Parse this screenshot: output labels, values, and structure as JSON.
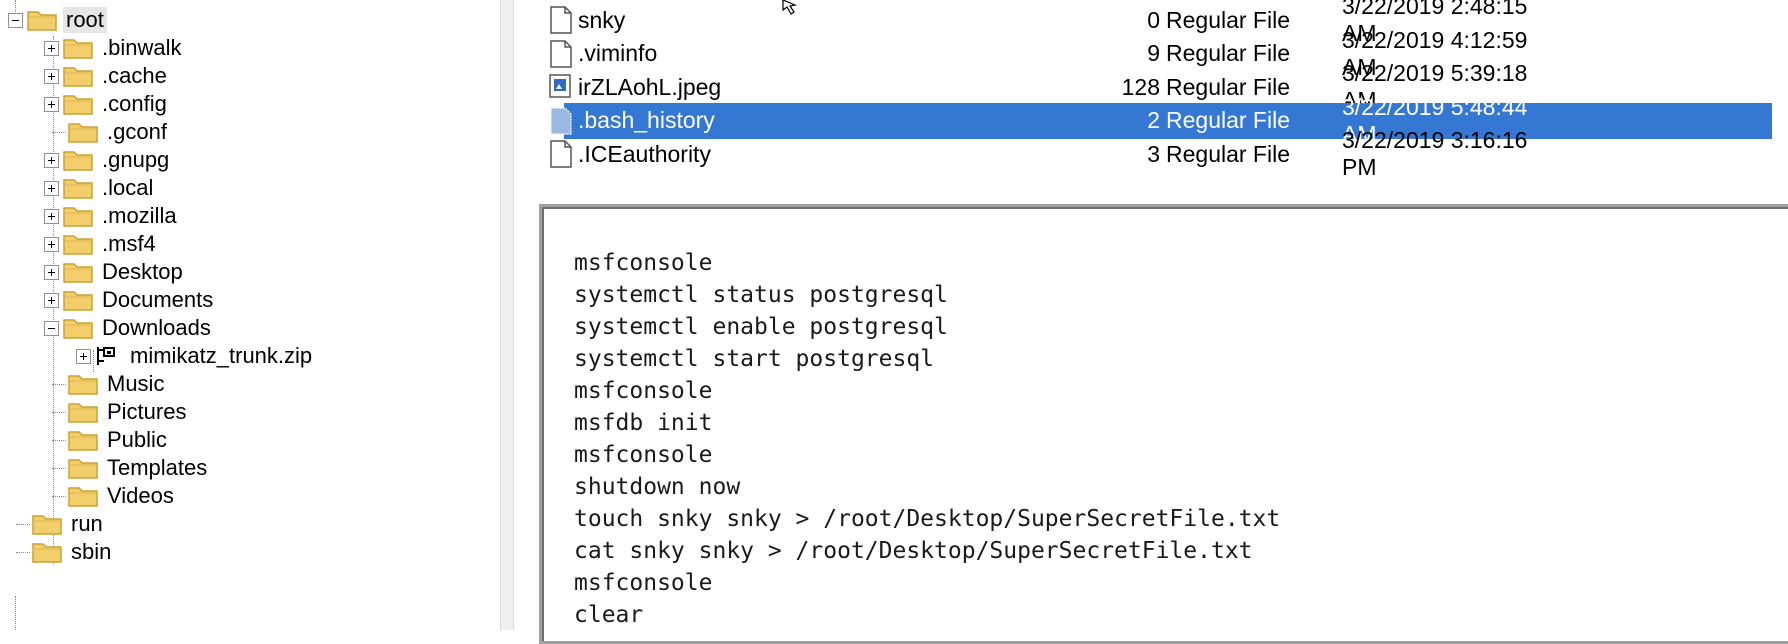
{
  "tree": {
    "root_label": "root",
    "items": [
      {
        "label": ".binwalk",
        "expandable": true
      },
      {
        "label": ".cache",
        "expandable": true
      },
      {
        "label": ".config",
        "expandable": true
      },
      {
        "label": ".gconf",
        "expandable": false
      },
      {
        "label": ".gnupg",
        "expandable": true
      },
      {
        "label": ".local",
        "expandable": true
      },
      {
        "label": ".mozilla",
        "expandable": true
      },
      {
        "label": ".msf4",
        "expandable": true
      },
      {
        "label": "Desktop",
        "expandable": true
      },
      {
        "label": "Documents",
        "expandable": true
      },
      {
        "label": "Downloads",
        "expanded": true
      },
      {
        "label": "mimikatz_trunk.zip",
        "child": true
      },
      {
        "label": "Music",
        "expandable": false
      },
      {
        "label": "Pictures",
        "expandable": false
      },
      {
        "label": "Public",
        "expandable": false
      },
      {
        "label": "Templates",
        "expandable": false
      },
      {
        "label": "Videos",
        "expandable": false
      }
    ],
    "after_root": [
      {
        "label": "run"
      },
      {
        "label": "sbin"
      }
    ]
  },
  "files": [
    {
      "name": "snky",
      "size": "0",
      "type": "Regular File",
      "date": "3/22/2019 2:48:15 AM",
      "icon": "file-icon"
    },
    {
      "name": ".viminfo",
      "size": "9",
      "type": "Regular File",
      "date": "3/22/2019 4:12:59 AM",
      "icon": "file-icon"
    },
    {
      "name": "irZLAohL.jpeg",
      "size": "128",
      "type": "Regular File",
      "date": "3/22/2019 5:39:18 AM",
      "icon": "image-file-icon"
    },
    {
      "name": ".bash_history",
      "size": "2",
      "type": "Regular File",
      "date": "3/22/2019 5:48:44 AM",
      "icon": "file-icon",
      "selected": true
    },
    {
      "name": ".ICEauthority",
      "size": "3",
      "type": "Regular File",
      "date": "3/22/2019 3:16:16 PM",
      "icon": "file-icon"
    }
  ],
  "viewer": {
    "lines": [
      "msfconsole",
      "systemctl status postgresql",
      "systemctl enable postgresql",
      "systemctl start postgresql",
      "msfconsole",
      "msfdb init",
      "msfconsole",
      "shutdown now",
      "touch snky snky > /root/Desktop/SuperSecretFile.txt",
      "cat snky snky > /root/Desktop/SuperSecretFile.txt",
      "msfconsole",
      "clear"
    ]
  },
  "colors": {
    "selection": "#3478d4",
    "folder": "#f3cf6b",
    "folder_edge": "#c9a032"
  }
}
